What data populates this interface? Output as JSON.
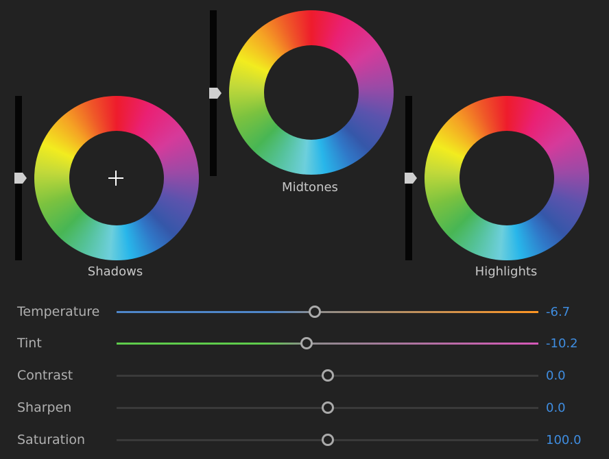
{
  "wheels": [
    {
      "id": "shadows",
      "label": "Shadows",
      "level": 0.5,
      "has_crosshair": true
    },
    {
      "id": "midtones",
      "label": "Midtones",
      "level": 0.5,
      "has_crosshair": false
    },
    {
      "id": "highlights",
      "label": "Highlights",
      "level": 0.5,
      "has_crosshair": false
    }
  ],
  "sliders": [
    {
      "id": "temperature",
      "label": "Temperature",
      "value": "-6.7",
      "position": 0.47,
      "colors": {
        "left": "#4f86c9",
        "right": "#ff9522"
      }
    },
    {
      "id": "tint",
      "label": "Tint",
      "value": "-10.2",
      "position": 0.45,
      "colors": {
        "left": "#5fcc4c",
        "right": "#d658b8"
      }
    },
    {
      "id": "contrast",
      "label": "Contrast",
      "value": "0.0",
      "position": 0.5,
      "colors": {
        "left": "#3a3a3a",
        "right": "#3a3a3a"
      }
    },
    {
      "id": "sharpen",
      "label": "Sharpen",
      "value": "0.0",
      "position": 0.5,
      "colors": {
        "left": "#3a3a3a",
        "right": "#3a3a3a"
      }
    },
    {
      "id": "saturation",
      "label": "Saturation",
      "value": "100.0",
      "position": 0.5,
      "colors": {
        "left": "#3a3a3a",
        "right": "#3a3a3a"
      }
    }
  ],
  "colors": {
    "background": "#222222",
    "value_text": "#3f8de0",
    "label_text": "#b0b0b0"
  }
}
